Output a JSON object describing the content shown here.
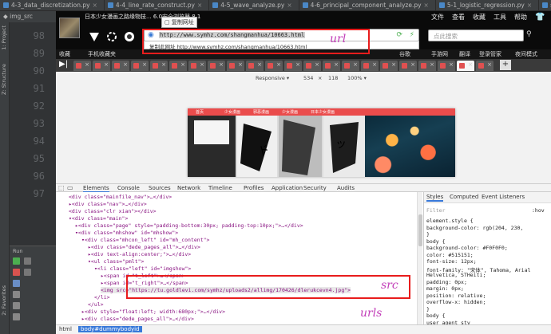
{
  "ide": {
    "tabs": [
      "4-3_data_discretization.py",
      "4-4_line_rate_construct.py",
      "4-5_wave_analyze.py",
      "4-6_principal_component_analyze.py",
      "5-1_logistic_regression.py",
      "spider.py"
    ],
    "breadcrumb": "img_src",
    "line_numbers": [
      "98",
      "89",
      "90",
      "91",
      "92",
      "93",
      "94",
      "95",
      "96",
      "97"
    ],
    "left_tools": [
      "1: Project",
      "Z: Structure",
      "2: Favorites"
    ],
    "run_label": "Run"
  },
  "browser": {
    "app_title": "日本少女漫画之路缘物技... 6.0安全浏览器 8.1",
    "menu": [
      "文件",
      "查看",
      "收藏",
      "工具",
      "帮助"
    ],
    "popup_label": "复制网址",
    "url": "http://www.symhz.com/shangmanhua/10663.html",
    "dropdown_text": "复制此网址   http://www.symhz.com/shangmanhua/10663.html",
    "search_placeholder": "点此搜索",
    "fav_items": [
      "收藏",
      "手机收藏夹",
      "谷歌",
      "手游网",
      "翻译",
      "登录管家",
      "夜间模式"
    ],
    "dev_toolbar": {
      "mode": "Responsive ▾",
      "width": "534",
      "x": "×",
      "height": "118",
      "zoom": "100% ▾"
    },
    "site_nav": [
      "首页",
      "少女漫画",
      "邪恶漫画",
      "少女漫画",
      "日本少女漫画"
    ],
    "devtools": {
      "tabs": [
        "Elements",
        "Console",
        "Sources",
        "Network",
        "Timeline",
        "Profiles",
        "Application",
        "Security",
        "Audits"
      ],
      "elements": [
        {
          "indent": 2,
          "html": "<div class=\"mainfile_nav\">…</div>"
        },
        {
          "indent": 2,
          "html": "▸<div class=\"nav\">…</div>"
        },
        {
          "indent": 2,
          "html": "<div class=\"clr xian\"></div>"
        },
        {
          "indent": 2,
          "html": "▾<div class=\"main\">"
        },
        {
          "indent": 3,
          "html": "▸<div class=\"page\" style=\"padding-bottom:30px; padding-top:10px;\">…</div>"
        },
        {
          "indent": 3,
          "html": "▾<div class=\"mhshow\" id=\"mhshow\">"
        },
        {
          "indent": 4,
          "html": "▾<div class=\"mhcon_left\" id=\"mh_content\">"
        },
        {
          "indent": 5,
          "html": "▸<div class=\"dede_pages_all\">…</div>"
        },
        {
          "indent": 5,
          "html": "▸<div text-align:center;\">…</div>"
        },
        {
          "indent": 5,
          "html": "▾<ul class=\"pmlt\">"
        },
        {
          "indent": 6,
          "html": "▾<li class=\"left\" id=\"imgshow\">"
        },
        {
          "indent": 7,
          "html": "▸<span id=\"t_left\">…</span>"
        },
        {
          "indent": 7,
          "html": "▸<span id=\"t_right\">…</span>"
        },
        {
          "indent": 7,
          "html": "<img src=\"https://tu.goldlevi.com/symhz/uploads2/allimg/170426/dlerukcevn4.jpg\">"
        },
        {
          "indent": 6,
          "html": "</li>"
        },
        {
          "indent": 5,
          "html": "</ul>"
        },
        {
          "indent": 4,
          "html": "▸<div style=\"float:left; width:680px;\">…</div>"
        },
        {
          "indent": 4,
          "html": "▸<div class=\"dede_pages_all\">…</div>"
        }
      ],
      "styles_tabs": [
        "Styles",
        "Computed",
        "Event Listeners"
      ],
      "filter_placeholder": "Filter",
      "filter_hov": ":hov",
      "styles": [
        "element.style {",
        "  background-color: rgb(204, 230,",
        "}",
        "body {",
        "  background-color: #F0F0F0;",
        "  color: #515151;",
        "  font-size: 12px;",
        "  font-family: \"宋体\", Tahoma, Arial",
        "      Helvetica, STHeiti;",
        "  padding: 0px;",
        "  margin: 0px;",
        "  position: relative;",
        "  overflow-x: hidden;",
        "}",
        "body {",
        "  user agent sty"
      ],
      "crumbs": [
        "html",
        "body#dummybodyid"
      ]
    }
  },
  "annotations": {
    "url": "url",
    "src": "src",
    "urls": "urls"
  },
  "colors": {
    "annotation_box": "#e81c1c",
    "annotation_text": "#c23db8",
    "site_accent": "#ea4c4c"
  }
}
